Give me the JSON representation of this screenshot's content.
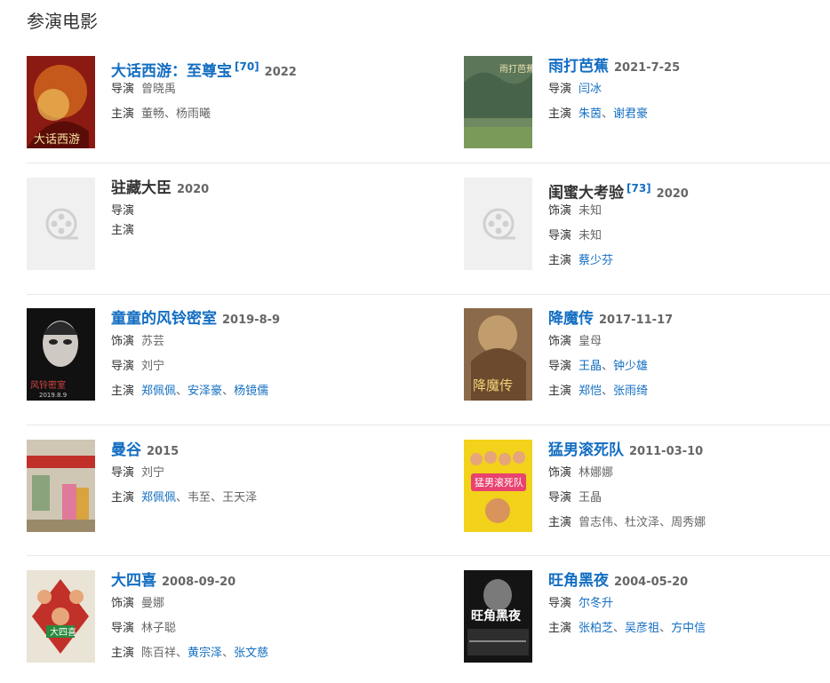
{
  "section_title": "参演电影",
  "labels": {
    "director": "导演",
    "star": "主演",
    "role": "饰演"
  },
  "separator": "、",
  "films": {
    "f1": {
      "title": "大话西游：至尊宝",
      "cite": "[70]",
      "year": "2022",
      "director": "曾晓禹",
      "stars": [
        "董畅",
        "杨雨曦"
      ]
    },
    "f2": {
      "title": "雨打芭蕉",
      "year": "2021-7-25",
      "director": "闫冰",
      "stars": [
        "朱茵",
        "谢君豪"
      ]
    },
    "f3": {
      "title": "驻藏大臣",
      "year": "2020"
    },
    "f4": {
      "title": "闺蜜大考验",
      "cite": "[73]",
      "year": "2020",
      "role": "未知",
      "director": "未知",
      "stars": [
        "蔡少芬"
      ]
    },
    "f5": {
      "title": "童童的风铃密室",
      "year": "2019-8-9",
      "role": "苏芸",
      "director": "刘宁",
      "stars": [
        "郑佩佩",
        "安泽豪",
        "杨镜儒"
      ]
    },
    "f6": {
      "title": "降魔传",
      "year": "2017-11-17",
      "role": "皇母",
      "director": [
        "王晶",
        "钟少雄"
      ],
      "stars": [
        "郑恺",
        "张雨绮"
      ]
    },
    "f7": {
      "title": "曼谷",
      "year": "2015",
      "director": "刘宁",
      "stars": [
        "郑佩佩",
        "韦至",
        "王天泽"
      ]
    },
    "f8": {
      "title": "猛男滚死队",
      "year": "2011-03-10",
      "role": "林娜娜",
      "director": "王晶",
      "stars": [
        "曾志伟",
        "杜汶泽",
        "周秀娜"
      ]
    },
    "f9": {
      "title": "大四喜",
      "year": "2008-09-20",
      "role": "曼娜",
      "director": "林子聪",
      "stars": [
        "陈百祥",
        "黄宗泽",
        "张文慈"
      ]
    },
    "f10": {
      "title": "旺角黑夜",
      "year": "2004-05-20",
      "director": "尔冬升",
      "stars": [
        "张柏芝",
        "吴彦祖",
        "方中信"
      ]
    }
  },
  "poster_text": {
    "f5": "2019.8.9",
    "f10": "旺角黑夜"
  }
}
